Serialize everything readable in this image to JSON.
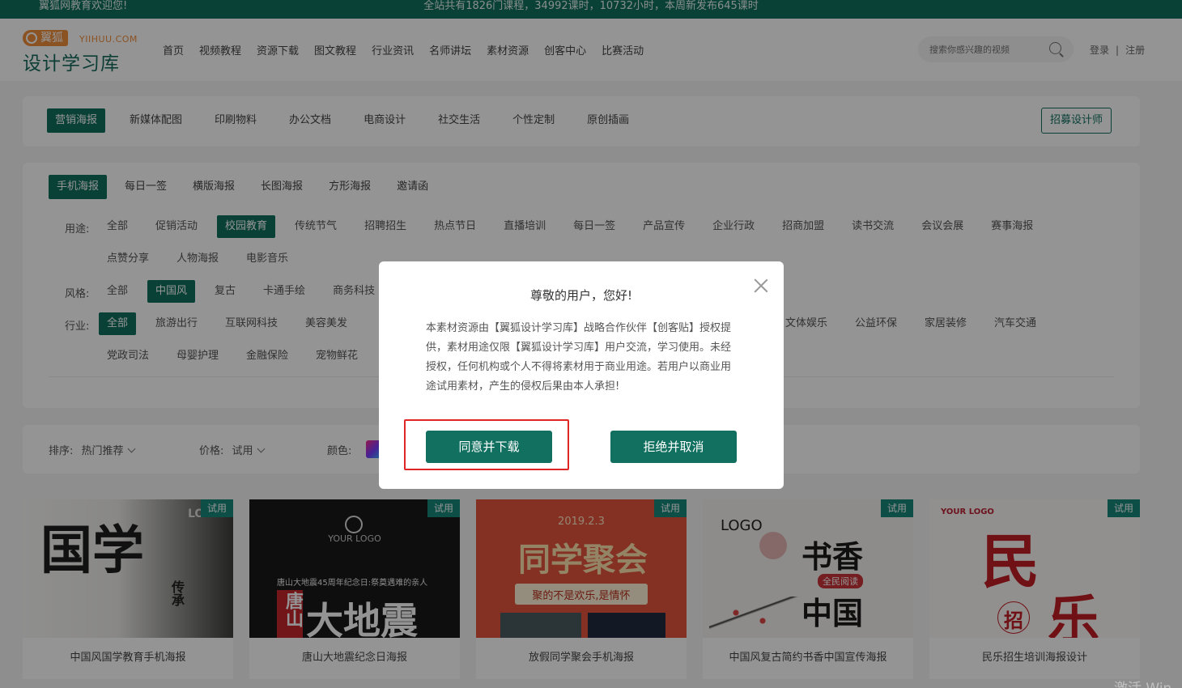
{
  "topbar": {
    "welcome": "翼狐网教育欢迎您!",
    "stats": "全站共有1826门课程，34992课时，10732小时，本周新发布645课时"
  },
  "logo": {
    "brand": "翼狐",
    "domain": "YIIHUU.COM",
    "name": "设计学习库"
  },
  "nav": [
    "首页",
    "视频教程",
    "资源下载",
    "图文教程",
    "行业资讯",
    "名师讲坛",
    "素材资源",
    "创客中心",
    "比赛活动"
  ],
  "search": {
    "placeholder": "搜索你感兴趣的视频"
  },
  "auth": {
    "login": "登录",
    "sep": "|",
    "register": "注册"
  },
  "category_tabs": [
    "营销海报",
    "新媒体配图",
    "印刷物料",
    "办公文档",
    "电商设计",
    "社交生活",
    "个性定制",
    "原创插画"
  ],
  "recruit_label": "招募设计师",
  "sub_tabs": [
    "手机海报",
    "每日一签",
    "横版海报",
    "长图海报",
    "方形海报",
    "邀请函"
  ],
  "filters": {
    "usage_label": "用途:",
    "usage": [
      "全部",
      "促销活动",
      "校园教育",
      "传统节气",
      "招聘招生",
      "热点节日",
      "直播培训",
      "每日一签",
      "产品宣传",
      "企业行政",
      "招商加盟",
      "读书交流",
      "会议会展",
      "赛事海报"
    ],
    "usage_row2": [
      "点赞分享",
      "人物海报",
      "电影音乐"
    ],
    "style_label": "风格:",
    "style": [
      "全部",
      "中国风",
      "复古",
      "卡通手绘",
      "商务科技"
    ],
    "industry_label": "行业:",
    "industry": [
      "全部",
      "旅游出行",
      "互联网科技",
      "美容美发"
    ],
    "industry_right": [
      "文体娱乐",
      "公益环保",
      "家居装修",
      "汽车交通"
    ],
    "industry_row2": [
      "党政司法",
      "母婴护理",
      "金融保险",
      "宠物鲜花"
    ]
  },
  "sort": {
    "sort_label": "排序:",
    "sort_value": "热门推荐",
    "price_label": "价格:",
    "price_value": "试用",
    "color_label": "颜色:"
  },
  "thumbs": [
    {
      "badge": "试用",
      "caption": "中国风国学教育手机海报",
      "art": "国学",
      "art2": "传承",
      "logo": "LOGO"
    },
    {
      "badge": "试用",
      "caption": "唐山大地震纪念日海报",
      "art": "大地震",
      "art2": "唐山",
      "logo": "YOUR LOGO",
      "sub": "唐山大地震45周年纪念日:祭奠遇难的亲人"
    },
    {
      "badge": "试用",
      "caption": "放假同学聚会手机海报",
      "art": "同学聚会",
      "date": "2019.2.3",
      "sub": "聚的不是欢乐,是情怀"
    },
    {
      "badge": "试用",
      "caption": "中国风复古简约书香中国宣传海报",
      "art": "书香",
      "art2": "中国",
      "logo": "LOGO",
      "sub": "全民阅读"
    },
    {
      "badge": "试用",
      "caption": "民乐招生培训海报设计",
      "art": "民",
      "art2": "乐",
      "logo": "YOUR LOGO",
      "sub": "招"
    }
  ],
  "dialog": {
    "title": "尊敬的用户，您好!",
    "body": "本素材资源由【翼狐设计学习库】战略合作伙伴【创客贴】授权提供，素材用途仅限【翼狐设计学习库】用户交流，学习使用。未经授权，任何机构或个人不得将素材用于商业用途。若用户以商业用途试用素材，产生的侵权后果由本人承担!",
    "agree": "同意并下载",
    "refuse": "拒绝并取消"
  },
  "watermark": "激活 Win",
  "colors": {
    "brand": "#11705f",
    "highlight": "#e02525"
  }
}
